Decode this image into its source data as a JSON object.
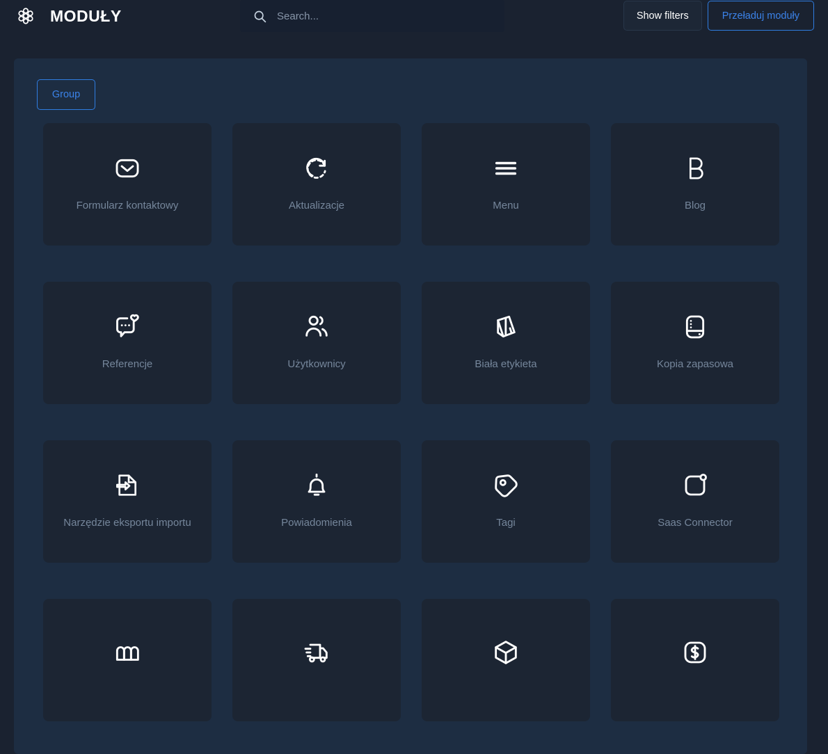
{
  "header": {
    "logo_icon": "flower-cluster-logo-icon",
    "title": "MODUŁY",
    "search": {
      "icon": "search-icon",
      "value": "",
      "placeholder": "Search..."
    },
    "buttons": {
      "show_filters": "Show filters",
      "reload_modules": "Przeładuj moduły"
    }
  },
  "toolbar": {
    "group_label": "Group"
  },
  "modules": [
    {
      "label": "Formularz kontaktowy",
      "icon": "envelope-icon"
    },
    {
      "label": "Aktualizacje",
      "icon": "refresh-icon"
    },
    {
      "label": "Menu",
      "icon": "hamburger-menu-icon"
    },
    {
      "label": "Blog",
      "icon": "letter-b-icon"
    },
    {
      "label": "Referencje",
      "icon": "chat-bubble-heart-icon"
    },
    {
      "label": "Użytkownicy",
      "icon": "users-icon"
    },
    {
      "label": "Biała etykieta",
      "icon": "tilted-book-icon"
    },
    {
      "label": "Kopia zapasowa",
      "icon": "server-drive-icon"
    },
    {
      "label": "Narzędzie eksportu importu",
      "icon": "document-arrow-icon"
    },
    {
      "label": "Powiadomienia",
      "icon": "bell-icon"
    },
    {
      "label": "Tagi",
      "icon": "tag-icon"
    },
    {
      "label": "Saas Connector",
      "icon": "rounded-square-dot-icon"
    },
    {
      "label": "",
      "icon": "wallet-icon"
    },
    {
      "label": "",
      "icon": "delivery-truck-icon"
    },
    {
      "label": "",
      "icon": "cube-box-icon"
    },
    {
      "label": "",
      "icon": "currency-square-icon"
    }
  ],
  "colors": {
    "page_background": "#1a2230",
    "panel_background": "#1d2d42",
    "card_background": "#1c2533",
    "accent_blue": "#3b82e8",
    "label_text": "#75869b",
    "header_text": "#ffffff"
  }
}
